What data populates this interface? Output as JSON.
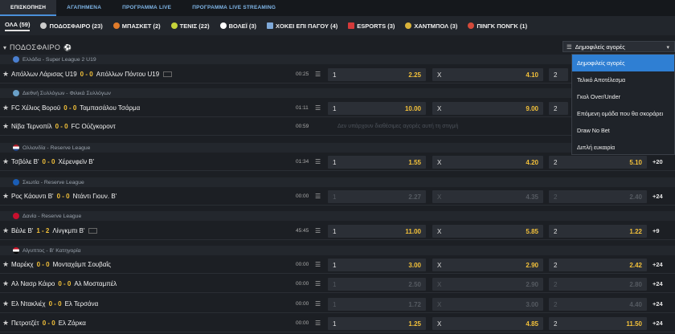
{
  "top_tabs": [
    "ΕΠΙΣΚΟΠΗΣΗ",
    "ΑΓΑΠΗΜΕΝΑ",
    "ΠΡΟΓΡΑΜΜΑ LIVE",
    "ΠΡΟΓΡΑΜΜΑ LIVE STREAMING"
  ],
  "sports": [
    {
      "label": "ΟΛΑ (59)",
      "color": ""
    },
    {
      "label": "ΠΟΔΟΣΦΑΙΡΟ (23)",
      "color": "#cccccc"
    },
    {
      "label": "ΜΠΑΣΚΕΤ (2)",
      "color": "#e07b2a"
    },
    {
      "label": "ΤΕΝΙΣ (22)",
      "color": "#c5d33a"
    },
    {
      "label": "ΒΟΛΕΪ (3)",
      "color": "#ffffff"
    },
    {
      "label": "ΧΟΚΕΙ ΕΠΙ ΠΑΓΟΥ (4)",
      "color": "#7fa9d9"
    },
    {
      "label": "ESPORTS (3)",
      "color": "#d43a3a"
    },
    {
      "label": "ΧΑΝΤΜΠΟΛ (3)",
      "color": "#d9b23a"
    },
    {
      "label": "ΠΙΝΓΚ ΠΟΝΓΚ (1)",
      "color": "#d44a3a"
    }
  ],
  "section_title": "ΠΟΔΟΣΦΑΙΡΟ",
  "markets_dropdown": {
    "selected": "Δημοφιλείς αγορές",
    "options": [
      "Δημοφιλείς αγορές",
      "Τελικό Αποτέλεσμα",
      "Γκολ Over/Under",
      "Επόμενη ομάδα που θα σκοράρει",
      "Draw No Bet",
      "Διπλή ευκαιρία"
    ]
  },
  "leagues": [
    {
      "name": "Ελλάδα - Super League 2 U19"
    },
    {
      "name": "Διεθνή Συλλόγων - Φιλικά Συλλόγων"
    },
    {
      "name": "Ολλανδία - Reserve League"
    },
    {
      "name": "Σκωτία - Reserve League"
    },
    {
      "name": "Δανία - Reserve League"
    },
    {
      "name": "Αίγυπτος - Β' Κατηγορία"
    }
  ],
  "matches": [
    {
      "home": "Απόλλων Λάρισας U19",
      "score": "0 - 0",
      "away": "Απόλλων Πόντου U19",
      "time": "00:25",
      "o1": "2.25",
      "ox": "4.10",
      "o2": "",
      "more": ""
    },
    {
      "home": "FC Χέλιος Βοροϋ",
      "score": "0 - 0",
      "away": "Ταμπασάλου Τσάρμα",
      "time": "01:11",
      "o1": "10.00",
      "ox": "9.00",
      "o2": "",
      "more": ""
    },
    {
      "home": "Νίβα Τερνοπίλ",
      "score": "0 - 0",
      "away": "FC Ούζγκοροντ",
      "time": "00:59",
      "no_markets": "Δεν υπάρχουν διαθέσιμες αγορές αυτή τη στιγμή",
      "more": ""
    },
    {
      "home": "Τσβόλε Β'",
      "score": "0 - 0",
      "away": "Χέρενφεϊν Β'",
      "time": "01:34",
      "o1": "1.55",
      "ox": "4.20",
      "o2": "5.10",
      "more": "+20"
    },
    {
      "home": "Ρος Κάουντι Β'",
      "score": "0 - 0",
      "away": "Ντάντι Γιουν. Β'",
      "time": "00:00",
      "o1": "2.27",
      "ox": "4.35",
      "o2": "2.40",
      "more": "+24"
    },
    {
      "home": "Βέιλε Β'",
      "score": "1 - 2",
      "away": "Λίνγκμπι Β'",
      "time": "45:45",
      "o1": "11.00",
      "ox": "5.85",
      "o2": "1.22",
      "more": "+9"
    },
    {
      "home": "Μαρέκχ",
      "score": "0 - 0",
      "away": "Μονταχάμπ Σουβαΐς",
      "time": "00:00",
      "o1": "3.00",
      "ox": "2.90",
      "o2": "2.42",
      "more": "+24"
    },
    {
      "home": "Αλ Νασρ Κάιρο",
      "score": "0 - 0",
      "away": "Αλ Μοσταμπέλ",
      "time": "00:00",
      "o1": "2.50",
      "ox": "2.90",
      "o2": "2.80",
      "more": "+24"
    },
    {
      "home": "Ελ Ντακλιέχ",
      "score": "0 - 0",
      "away": "Ελ Τερσάνα",
      "time": "00:00",
      "o1": "1.72",
      "ox": "3.00",
      "o2": "4.40",
      "more": "+24"
    },
    {
      "home": "Πετροτζέτ",
      "score": "0 - 0",
      "away": "Ελ Ζάρκα",
      "time": "00:00",
      "o1": "1.25",
      "ox": "4.85",
      "o2": "11.50",
      "more": "+24"
    }
  ],
  "labels": {
    "l1": "1",
    "lx": "X",
    "l2": "2"
  },
  "colors": {
    "accent": "#2f7fd3",
    "odds": "#f3c13a",
    "bg": "#1c1f24"
  }
}
